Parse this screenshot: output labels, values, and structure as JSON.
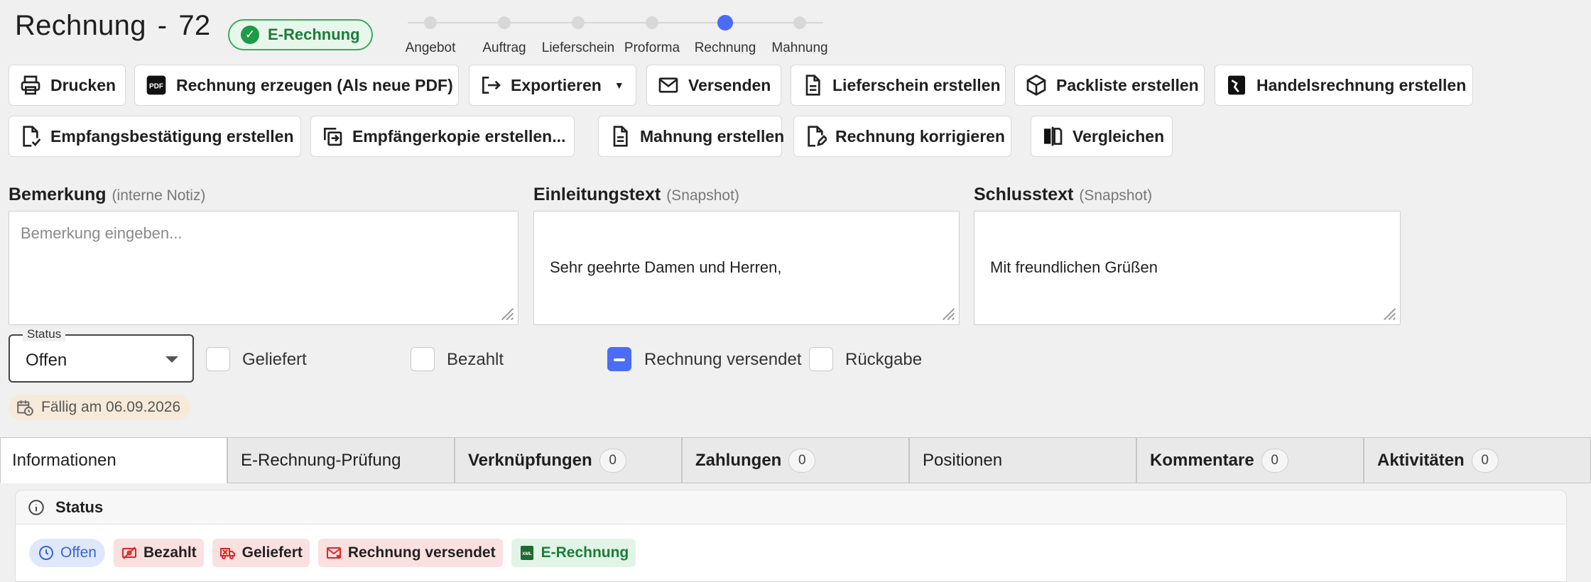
{
  "header": {
    "doc_type": "Rechnung",
    "separator": "-",
    "number": "72",
    "badge": "E-Rechnung"
  },
  "stepper": {
    "steps": [
      "Angebot",
      "Auftrag",
      "Lieferschein",
      "Proforma",
      "Rechnung",
      "Mahnung"
    ],
    "active": "Rechnung"
  },
  "toolbar": {
    "row1": [
      "Drucken",
      "Rechnung erzeugen (Als neue PDF)",
      "Exportieren",
      "Versenden",
      "Lieferschein erstellen",
      "Packliste erstellen",
      "Handelsrechnung erstellen"
    ],
    "row2": [
      "Empfangsbestätigung erstellen",
      "Empfängerkopie erstellen...",
      "Mahnung erstellen",
      "Rechnung korrigieren",
      "Vergleichen"
    ]
  },
  "fields": {
    "bemerkung": {
      "label": "Bemerkung",
      "hint": "(interne Notiz)",
      "placeholder": "Bemerkung eingeben..."
    },
    "einleitung": {
      "label": "Einleitungstext",
      "hint": "(Snapshot)",
      "value": "Sehr geehrte Damen und Herren,"
    },
    "schluss": {
      "label": "Schlusstext",
      "hint": "(Snapshot)",
      "value": "Mit freundlichen Grüßen"
    }
  },
  "status_select": {
    "label": "Status",
    "value": "Offen"
  },
  "checkboxes": [
    {
      "label": "Geliefert",
      "checked": false
    },
    {
      "label": "Bezahlt",
      "checked": false
    },
    {
      "label": "Rechnung versendet",
      "checked": true
    },
    {
      "label": "Rückgabe",
      "checked": false
    }
  ],
  "due": "Fällig am 06.09.2026",
  "tabs": [
    {
      "label": "Informationen",
      "count": null
    },
    {
      "label": "E-Rechnung-Prüfung",
      "count": null
    },
    {
      "label": "Verknüpfungen",
      "count": "0"
    },
    {
      "label": "Zahlungen",
      "count": "0"
    },
    {
      "label": "Positionen",
      "count": null
    },
    {
      "label": "Kommentare",
      "count": "0"
    },
    {
      "label": "Aktivitäten",
      "count": "0"
    }
  ],
  "status_card": {
    "title": "Status",
    "chips": [
      "Offen",
      "Bezahlt",
      "Geliefert",
      "Rechnung versendet",
      "E-Rechnung"
    ]
  },
  "colors": {
    "accent": "#4a6cf7",
    "success": "#1f9a46",
    "danger_bg": "#fbe0e0",
    "info_bg": "#dfe8fb"
  }
}
